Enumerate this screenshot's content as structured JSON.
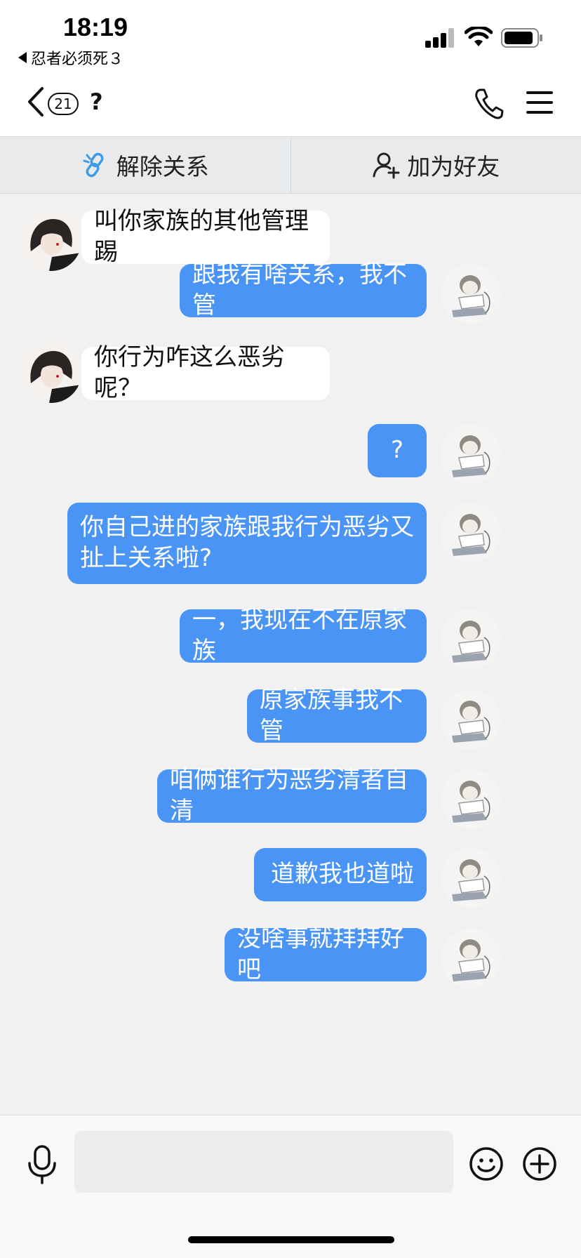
{
  "status_bar": {
    "time": "18:19",
    "back_app": "忍者必须死３"
  },
  "header": {
    "unread_count": "21",
    "title": "?"
  },
  "actions": {
    "unlink_label": "解除关系",
    "add_friend_label": "加为好友"
  },
  "messages": [
    {
      "side": "left",
      "text": "叫你家族的其他管理踢"
    },
    {
      "side": "right",
      "text": "跟我有啥关系，我不管"
    },
    {
      "side": "left",
      "text": "你行为咋这么恶劣呢？"
    },
    {
      "side": "right",
      "text": "?"
    },
    {
      "side": "right",
      "text": "你自己进的家族跟我行为恶劣又扯上关系啦?"
    },
    {
      "side": "right",
      "text": "一，我现在不在原家族"
    },
    {
      "side": "right",
      "text": "原家族事我不管"
    },
    {
      "side": "right",
      "text": "咱俩谁行为恶劣清者自清"
    },
    {
      "side": "right",
      "text": "道歉我也道啦"
    },
    {
      "side": "right",
      "text": "没啥事就拜拜好吧"
    }
  ],
  "input": {
    "placeholder": ""
  },
  "colors": {
    "bubble_right": "#4a94f5",
    "bubble_left": "#ffffff",
    "background": "#f1f1f1",
    "link_icon": "#3b9bea"
  },
  "icons": [
    "back-chevron-icon",
    "phone-icon",
    "menu-icon",
    "unlink-icon",
    "add-user-icon",
    "microphone-icon",
    "emoji-icon",
    "plus-icon"
  ]
}
